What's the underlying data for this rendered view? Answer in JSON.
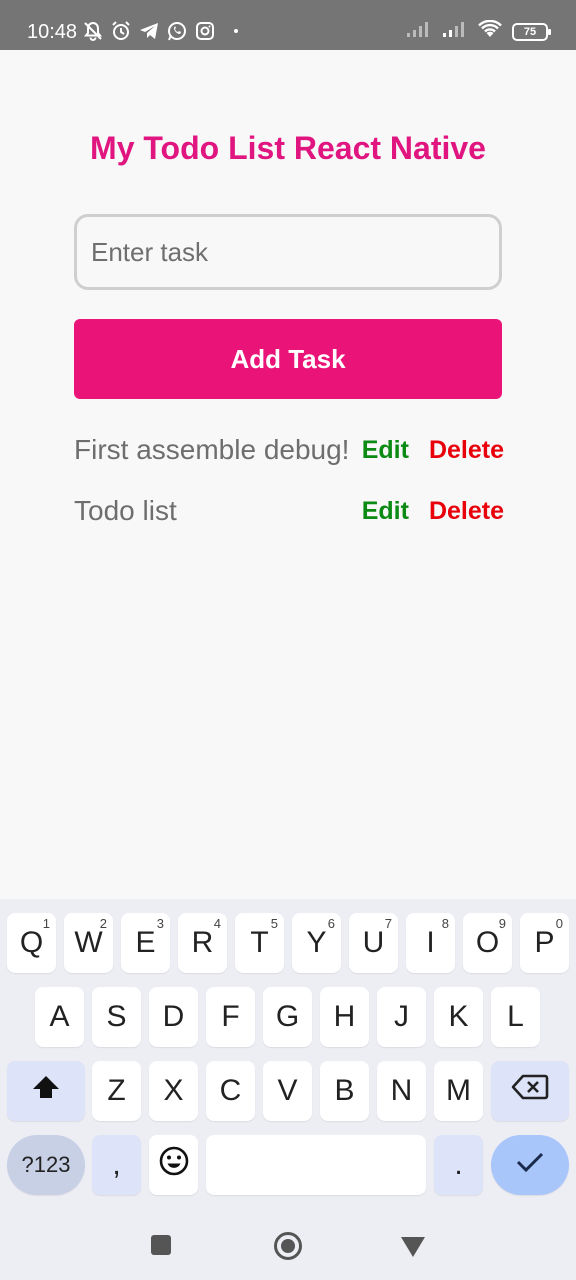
{
  "status_bar": {
    "time": "10:48",
    "battery": "75",
    "icons_left": [
      "mute-bell-icon",
      "alarm-icon",
      "telegram-icon",
      "whatsapp-icon",
      "instagram-icon"
    ],
    "icons_right": [
      "signal-icon",
      "signal-icon",
      "wifi-icon",
      "battery-icon"
    ]
  },
  "app": {
    "title": "My Todo List React Native",
    "input": {
      "placeholder": "Enter task",
      "value": ""
    },
    "add_button_label": "Add Task",
    "tasks": [
      {
        "text": "First assemble debug!",
        "edit_label": "Edit",
        "delete_label": "Delete"
      },
      {
        "text": "Todo list",
        "edit_label": "Edit",
        "delete_label": "Delete"
      }
    ]
  },
  "keyboard": {
    "row1": [
      {
        "key": "Q",
        "hint": "1"
      },
      {
        "key": "W",
        "hint": "2"
      },
      {
        "key": "E",
        "hint": "3"
      },
      {
        "key": "R",
        "hint": "4"
      },
      {
        "key": "T",
        "hint": "5"
      },
      {
        "key": "Y",
        "hint": "6"
      },
      {
        "key": "U",
        "hint": "7"
      },
      {
        "key": "I",
        "hint": "8"
      },
      {
        "key": "O",
        "hint": "9"
      },
      {
        "key": "P",
        "hint": "0"
      }
    ],
    "row2": [
      "A",
      "S",
      "D",
      "F",
      "G",
      "H",
      "J",
      "K",
      "L"
    ],
    "row3": [
      "Z",
      "X",
      "C",
      "V",
      "B",
      "N",
      "M"
    ],
    "symbols_label": "?123",
    "comma_label": ",",
    "period_label": "."
  },
  "colors": {
    "accent": "#ea1479",
    "title": "#e0157f",
    "edit": "#0b8a14",
    "delete": "#e8000b"
  }
}
